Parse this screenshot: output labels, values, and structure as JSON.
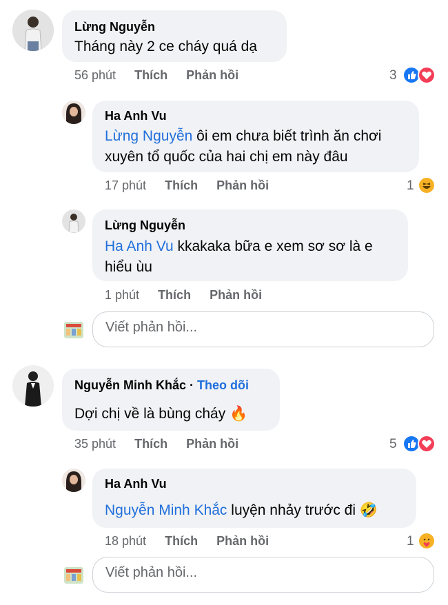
{
  "comments": [
    {
      "author": "Lừng Nguyễn",
      "text": "Tháng này 2 ce cháy quá dạ",
      "time": "56 phút",
      "like_label": "Thích",
      "reply_label": "Phản hồi",
      "reaction_count": "3",
      "reactions": [
        "like-icon",
        "love-icon"
      ],
      "replies": [
        {
          "author": "Ha Anh Vu",
          "mention": "Lừng Nguyễn",
          "text_line1": " ôi em chưa biết trình ăn chơi",
          "text_line2": "xuyên tổ quốc của  hai chị em này đâu",
          "time": "17 phút",
          "like_label": "Thích",
          "reply_label": "Phản hồi",
          "reaction_count": "1",
          "reactions": [
            "haha-icon"
          ]
        },
        {
          "author": "Lừng Nguyễn",
          "mention": "Ha Anh Vu",
          "text_line1": "  kkakaka bữa e xem sơ sơ là e",
          "text_line2": "hiểu ùu",
          "time": "1 phút",
          "like_label": "Thích",
          "reply_label": "Phản hồi"
        }
      ],
      "reply_placeholder": "Viết phản hồi..."
    },
    {
      "author": "Nguyễn Minh Khắc",
      "separator": " · ",
      "follow_label": "Theo dõi",
      "text": "Dợi chị về là bùng cháy",
      "emoji": "🔥",
      "time": "35 phút",
      "like_label": "Thích",
      "reply_label": "Phản hồi",
      "reaction_count": "5",
      "reactions": [
        "like-icon",
        "love-icon"
      ],
      "replies": [
        {
          "author": "Ha Anh Vu",
          "mention": "Nguyễn Minh Khắc",
          "text_line1": " luyện nhảy trước đi",
          "emoji": "🤣",
          "time": "18 phút",
          "like_label": "Thích",
          "reply_label": "Phản hồi",
          "reaction_count": "1",
          "reactions": [
            "care-icon"
          ]
        }
      ],
      "reply_placeholder": "Viết phản hồi..."
    }
  ],
  "colors": {
    "bubble": "#f0f2f5",
    "mention": "#216fdb",
    "meta": "#65676b",
    "like": "#1877f2",
    "love": "#f33e58",
    "haha": "#f7b125"
  }
}
